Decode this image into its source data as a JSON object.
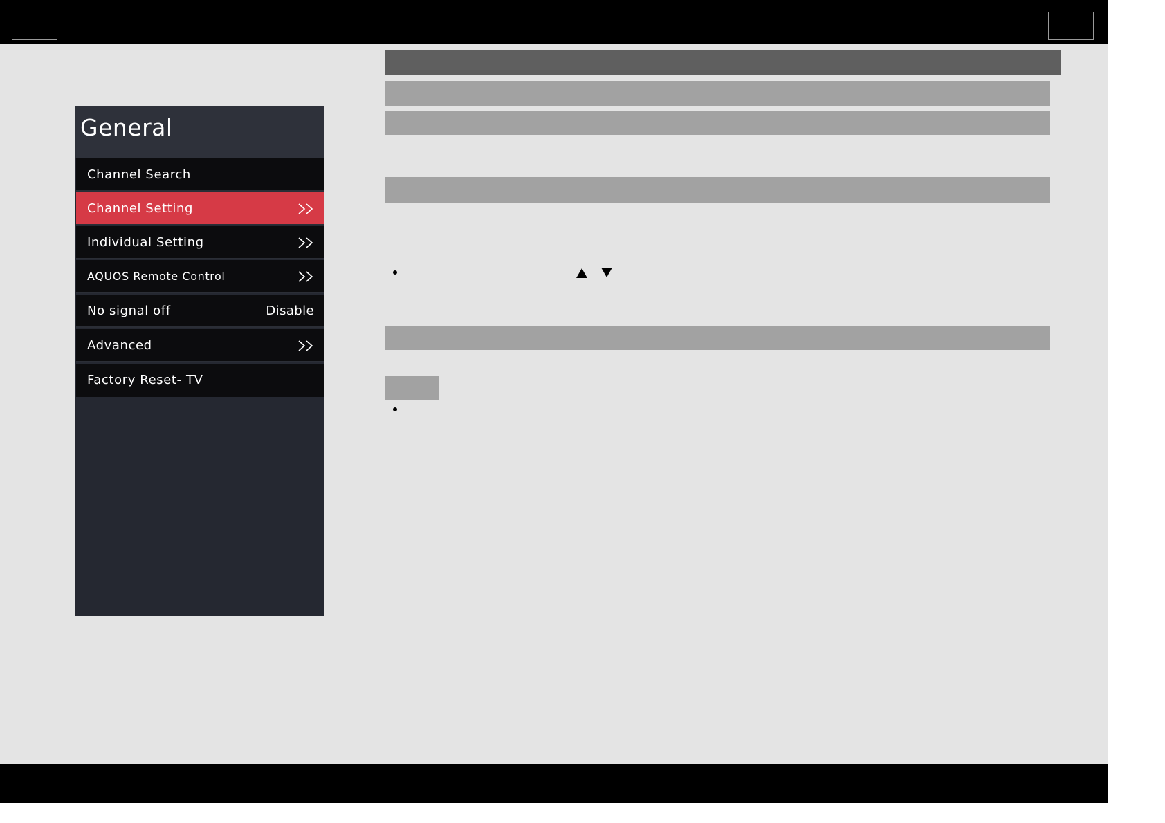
{
  "menu": {
    "title": "General",
    "items": [
      {
        "label": "Channel Search",
        "value": "",
        "submenu": false,
        "selected": false
      },
      {
        "label": "Channel Setting",
        "value": "",
        "submenu": true,
        "selected": true
      },
      {
        "label": "Individual Setting",
        "value": "",
        "submenu": true,
        "selected": false
      },
      {
        "label": "AQUOS Remote Control",
        "value": "",
        "submenu": true,
        "selected": false
      },
      {
        "label": "No signal off",
        "value": "Disable",
        "submenu": false,
        "selected": false
      },
      {
        "label": "Advanced",
        "value": "",
        "submenu": true,
        "selected": false
      },
      {
        "label": "Factory Reset- TV",
        "value": "",
        "submenu": false,
        "selected": false
      }
    ]
  },
  "icons": {
    "submenu": "double-chevron-right-icon",
    "up": "up-triangle-icon",
    "down": "down-triangle-icon"
  },
  "colors": {
    "selected_item": "#d63a46",
    "menu_background": "#252831",
    "page_background": "#e4e4e4",
    "section_bar": "#a2a2a2",
    "header_bar": "#5f5f5f"
  }
}
